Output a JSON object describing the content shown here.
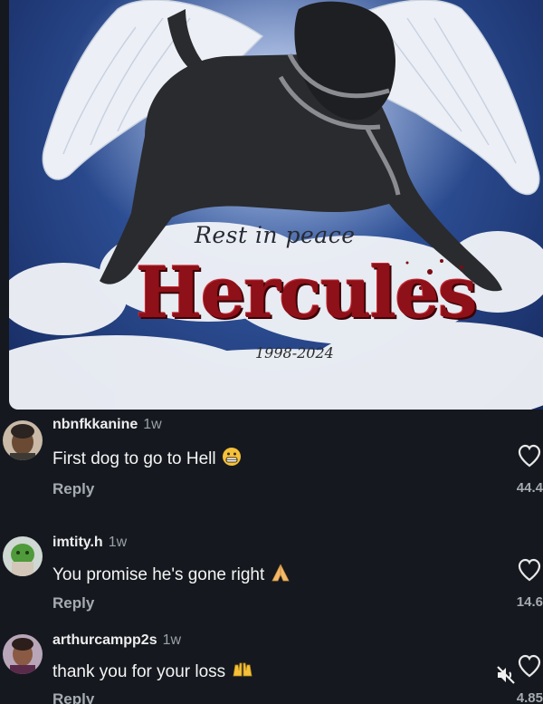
{
  "post_image": {
    "rest_text": "Rest in peace",
    "name_text": "Hercules",
    "years_text": "1998-2024"
  },
  "comments": [
    {
      "username": "nbnfkkanine",
      "time": "1w",
      "text": "First dog to go to Hell",
      "emoji": "grimacing-face-emoji",
      "reply_label": "Reply",
      "likes": "44.4"
    },
    {
      "username": "imtity.h",
      "time": "1w",
      "text": "You promise he's gone right",
      "emoji": "folded-hands-emoji",
      "reply_label": "Reply",
      "likes": "14.6"
    },
    {
      "username": "arthurcampp2s",
      "time": "1w",
      "text": "thank you for your loss",
      "emoji": "raising-hands-emoji",
      "reply_label": "Reply",
      "likes": "4.85"
    }
  ],
  "icons": {
    "like": "heart-outline-icon",
    "sound": "muted-speaker-icon"
  },
  "colors": {
    "background": "#15191f",
    "sky": "#2c4d92",
    "name_red": "#8e1018",
    "secondary_text": "#a6abb2"
  }
}
